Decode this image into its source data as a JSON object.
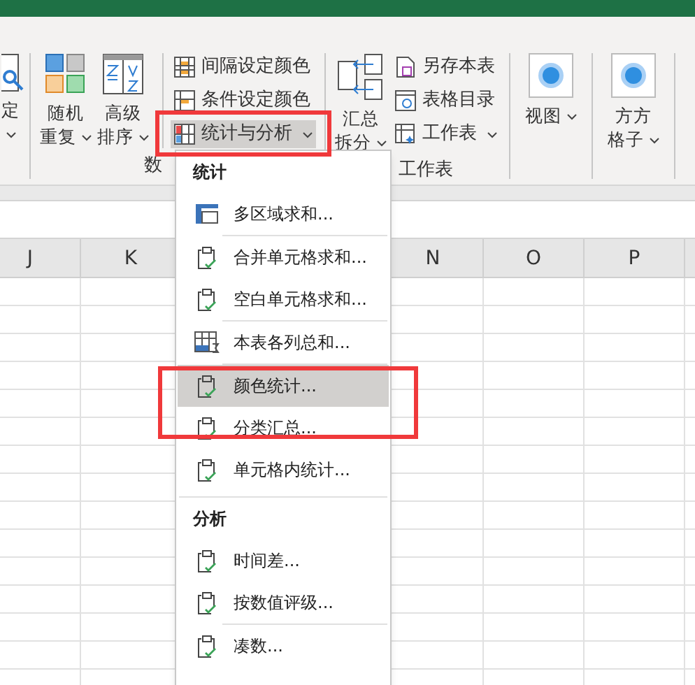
{
  "ribbon": {
    "groups": [
      {
        "items": [
          {
            "kind": "large",
            "label": "定",
            "dropdown": true
          }
        ]
      },
      {
        "label": "数",
        "items": [
          {
            "kind": "large",
            "label": "随机重复",
            "dropdown": true
          },
          {
            "kind": "large",
            "label": "高级排序",
            "dropdown": true
          },
          {
            "kind": "stack",
            "items": [
              {
                "label": "间隔设定颜色",
                "dropdown": false,
                "pressed": false
              },
              {
                "label": "条件设定颜色",
                "dropdown": false,
                "pressed": false
              },
              {
                "label": "统计与分析",
                "dropdown": true,
                "pressed": true
              }
            ]
          }
        ]
      },
      {
        "label": "工作表",
        "items": [
          {
            "kind": "large",
            "label": "汇总拆分",
            "dropdown": true
          },
          {
            "kind": "stack",
            "items": [
              {
                "label": "另存本表",
                "dropdown": false,
                "pressed": false
              },
              {
                "label": "表格目录",
                "dropdown": false,
                "pressed": false
              },
              {
                "label": "工作表",
                "dropdown": true,
                "pressed": false
              }
            ]
          }
        ]
      },
      {
        "items": [
          {
            "kind": "large",
            "label": "视图",
            "dropdown": true
          }
        ]
      },
      {
        "items": [
          {
            "kind": "large",
            "label": "方方格子",
            "dropdown": true
          }
        ]
      }
    ]
  },
  "sheet": {
    "columns": [
      {
        "label": "J"
      },
      {
        "label": "K"
      },
      {
        "label": "N"
      },
      {
        "label": "O"
      },
      {
        "label": "P"
      }
    ]
  },
  "menu": {
    "sections": [
      {
        "title": "统计",
        "items": [
          {
            "kind": "table",
            "label": "多区域求和...",
            "highlighted": false,
            "separator_after": true
          },
          {
            "kind": "clipboard",
            "label": "合并单元格求和...",
            "highlighted": false,
            "separator_after": false
          },
          {
            "kind": "clipboard",
            "label": "空白单元格求和...",
            "highlighted": false,
            "separator_after": true
          },
          {
            "kind": "column-sum",
            "label": "本表各列总和...",
            "highlighted": false,
            "separator_after": true
          },
          {
            "kind": "clipboard",
            "label": "颜色统计...",
            "highlighted": true,
            "separator_after": false
          },
          {
            "kind": "clipboard",
            "label": "分类汇总...",
            "highlighted": false,
            "separator_after": false
          },
          {
            "kind": "clipboard",
            "label": "单元格内统计...",
            "highlighted": false,
            "separator_after": false
          }
        ]
      },
      {
        "title": "分析",
        "items": [
          {
            "kind": "clipboard",
            "label": "时间差...",
            "highlighted": false,
            "separator_after": false
          },
          {
            "kind": "clipboard",
            "label": "按数值评级...",
            "highlighted": false,
            "separator_after": true
          },
          {
            "kind": "clipboard",
            "label": "凑数...",
            "highlighted": false,
            "separator_after": false
          }
        ]
      }
    ]
  }
}
